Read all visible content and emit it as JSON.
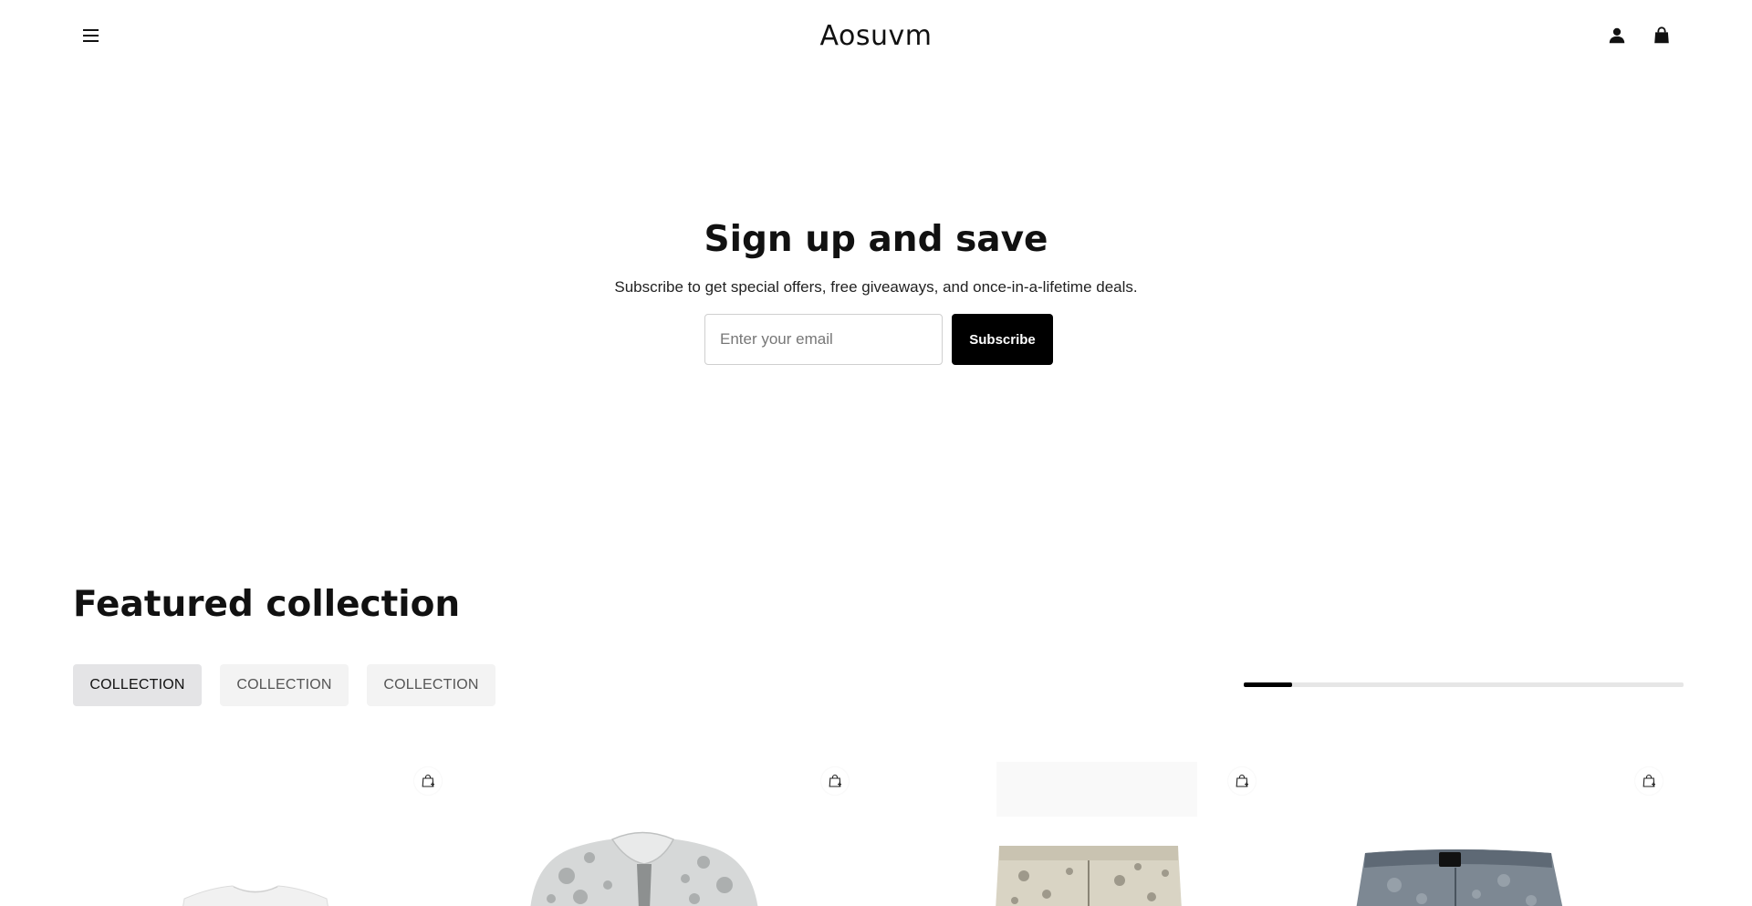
{
  "header": {
    "logo": "Aosuvm",
    "menu_icon": "hamburger-menu-icon",
    "account_icon": "user-icon",
    "cart_icon": "shopping-bag-icon"
  },
  "newsletter": {
    "title": "Sign up and save",
    "subtitle": "Subscribe to get special offers, free giveaways, and once-in-a-lifetime deals.",
    "email_placeholder": "Enter your email",
    "subscribe_label": "Subscribe"
  },
  "featured": {
    "title": "Featured collection",
    "tabs": [
      {
        "label": "COLLECTION",
        "active": true
      },
      {
        "label": "COLLECTION",
        "active": false
      },
      {
        "label": "COLLECTION",
        "active": false
      }
    ],
    "scroll_progress": 0.11,
    "products": [
      {
        "image": "white-tshirt",
        "quick_add_icon": "bag-plus-icon"
      },
      {
        "image": "patterned-polo-shirt",
        "quick_add_icon": "bag-plus-icon"
      },
      {
        "image": "patterned-beige-pants",
        "quick_add_icon": "bag-plus-icon"
      },
      {
        "image": "washed-denim-jeans",
        "quick_add_icon": "bag-plus-icon"
      }
    ]
  },
  "colors": {
    "primary": "#000000",
    "background": "#ffffff",
    "tab_active_bg": "#e4e4e6",
    "tab_bg": "#f3f3f3",
    "track": "#e6e6e6"
  }
}
